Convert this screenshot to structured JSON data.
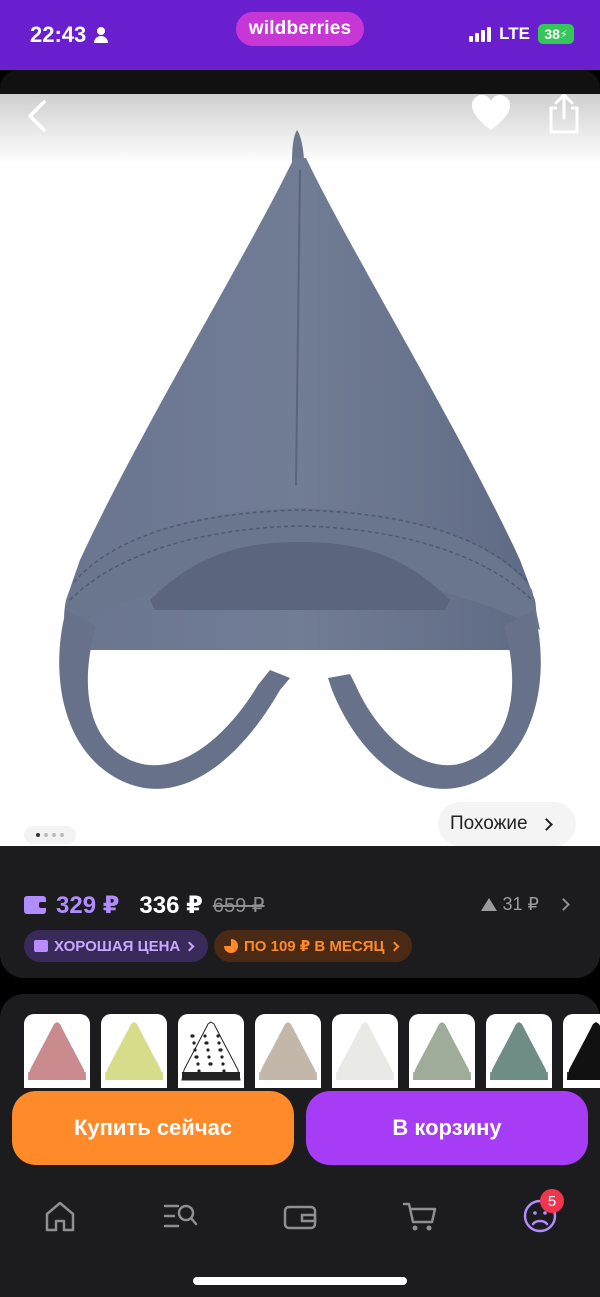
{
  "status_bar": {
    "time": "22:43",
    "brand": "wildberries",
    "network": "LTE",
    "battery": "38"
  },
  "product_image": {
    "hat_color": "#67728a",
    "gallery_page": 1,
    "gallery_pages": 4
  },
  "similar": {
    "label": "Похожие"
  },
  "prices": {
    "wallet_price": "329 ₽",
    "price": "336 ₽",
    "old_price": "659 ₽",
    "price_change": "31 ₽"
  },
  "badges": {
    "good_price": "ХОРОШАЯ ЦЕНА",
    "installment": "ПО 109 ₽ В МЕСЯЦ"
  },
  "variants": [
    {
      "color": "#c98b8e"
    },
    {
      "color": "#d7dc8a"
    },
    {
      "color": "#ffffff",
      "pattern": "dots"
    },
    {
      "color": "#c3b7aa"
    },
    {
      "color": "#e9e9e6"
    },
    {
      "color": "#9fac9a"
    },
    {
      "color": "#6f8d84"
    },
    {
      "color": "#111111"
    }
  ],
  "actions": {
    "buy_now": "Купить сейчас",
    "add_to_cart": "В корзину"
  },
  "tabbar": {
    "items": [
      "home-icon",
      "catalog-search-icon",
      "wallet-icon",
      "cart-icon",
      "profile-icon"
    ],
    "profile_badge": "5"
  },
  "colors": {
    "brand_purple": "#6a1fcf",
    "accent_orange": "#ff8a2a",
    "accent_purple": "#a63cf6",
    "price_purple": "#b18cff"
  }
}
